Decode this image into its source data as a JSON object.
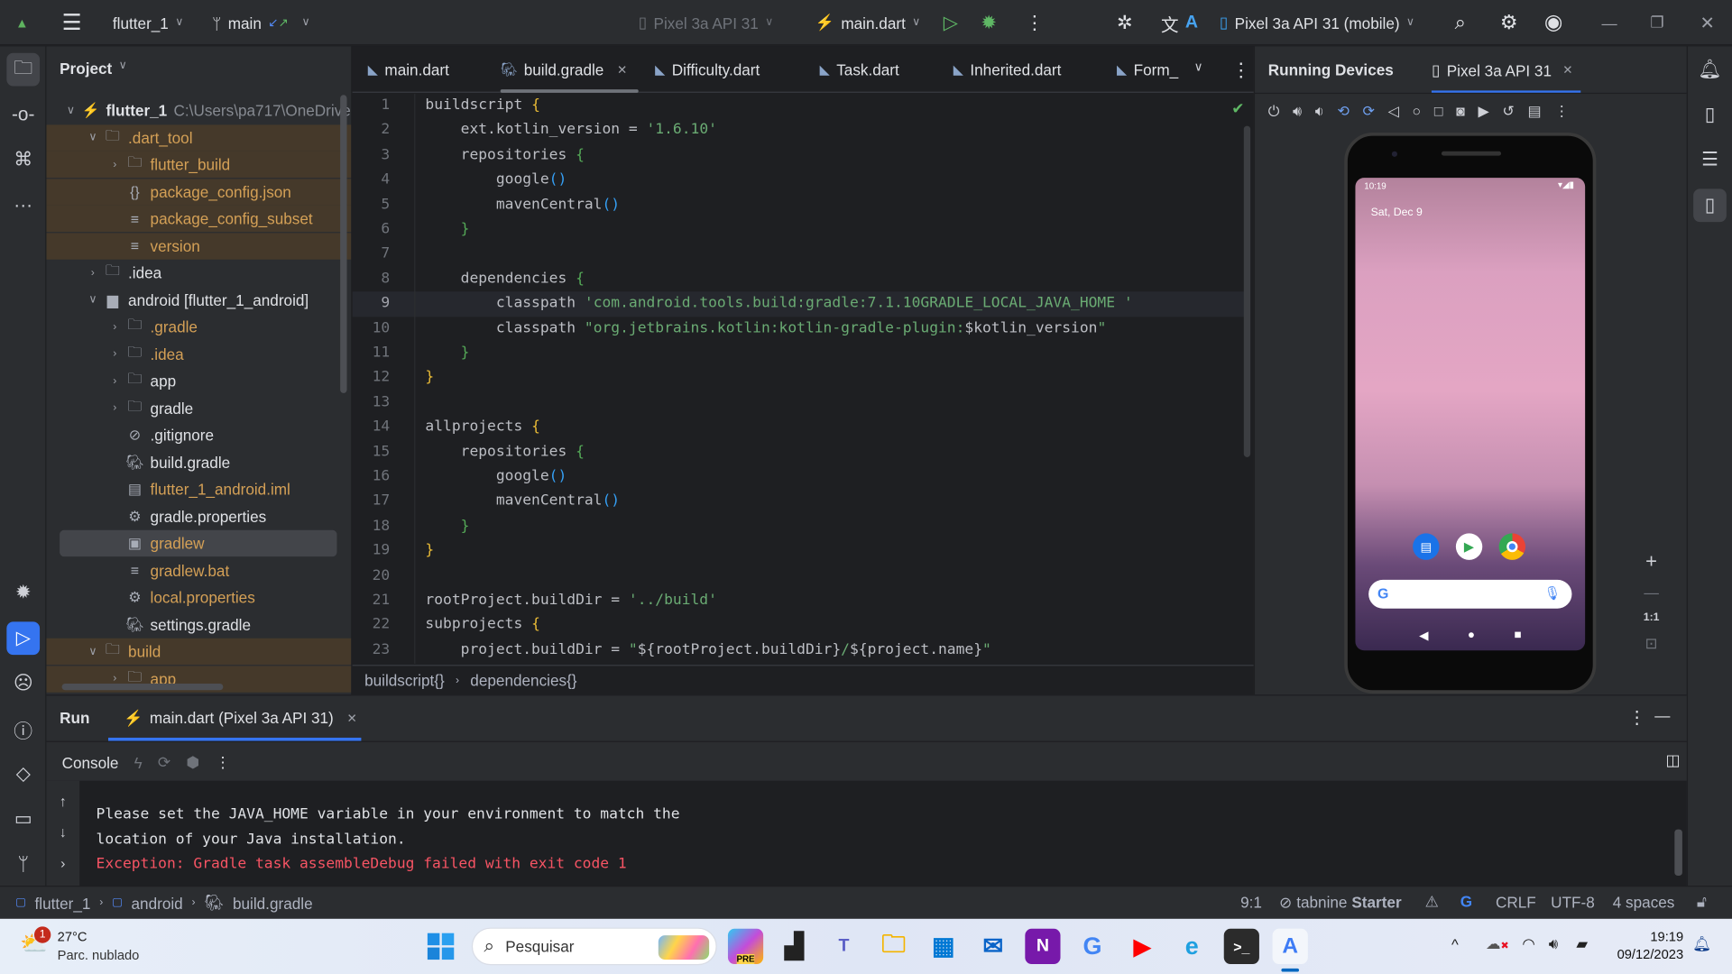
{
  "topbar": {
    "project": "flutter_1",
    "branch": "main",
    "device_config": "Pixel 3a API 31",
    "run_config": "main.dart",
    "device_selector": "Pixel 3a API 31 (mobile)"
  },
  "project_panel": {
    "title": "Project",
    "tree": [
      {
        "name": "flutter_1",
        "extra": "C:\\Users\\pa717\\OneDrive",
        "level": 0,
        "chev": "v",
        "icon": "flutter-icon",
        "color": "#dfe1e5",
        "bg": ""
      },
      {
        "name": ".dart_tool",
        "level": 1,
        "chev": "v",
        "icon": "folder-icon",
        "color": "#d4a056",
        "bg": "#45392a"
      },
      {
        "name": "flutter_build",
        "level": 2,
        "chev": ">",
        "icon": "folder-icon",
        "color": "#d4a056",
        "bg": "#45392a"
      },
      {
        "name": "package_config.json",
        "level": 2,
        "chev": "",
        "icon": "json-icon",
        "color": "#d4a056",
        "bg": "#45392a"
      },
      {
        "name": "package_config_subset",
        "level": 2,
        "chev": "",
        "icon": "text-file-icon",
        "color": "#d4a056",
        "bg": "#45392a"
      },
      {
        "name": "version",
        "level": 2,
        "chev": "",
        "icon": "text-file-icon",
        "color": "#d4a056",
        "bg": "#45392a"
      },
      {
        "name": ".idea",
        "level": 1,
        "chev": ">",
        "icon": "folder-icon",
        "color": "#dfe1e5",
        "bg": ""
      },
      {
        "name": "android [flutter_1_android]",
        "level": 1,
        "chev": "v",
        "icon": "module-folder-icon",
        "color": "#dfe1e5",
        "bg": ""
      },
      {
        "name": ".gradle",
        "level": 2,
        "chev": ">",
        "icon": "folder-icon",
        "color": "#d4a056",
        "bg": ""
      },
      {
        "name": ".idea",
        "level": 2,
        "chev": ">",
        "icon": "folder-icon",
        "color": "#d4a056",
        "bg": ""
      },
      {
        "name": "app",
        "level": 2,
        "chev": ">",
        "icon": "folder-icon",
        "color": "#dfe1e5",
        "bg": ""
      },
      {
        "name": "gradle",
        "level": 2,
        "chev": ">",
        "icon": "folder-icon",
        "color": "#dfe1e5",
        "bg": ""
      },
      {
        "name": ".gitignore",
        "level": 2,
        "chev": "",
        "icon": "ignore-file-icon",
        "color": "#dfe1e5",
        "bg": ""
      },
      {
        "name": "build.gradle",
        "level": 2,
        "chev": "",
        "icon": "gradle-icon",
        "color": "#dfe1e5",
        "bg": ""
      },
      {
        "name": "flutter_1_android.iml",
        "level": 2,
        "chev": "",
        "icon": "iml-file-icon",
        "color": "#d4a056",
        "bg": ""
      },
      {
        "name": "gradle.properties",
        "level": 2,
        "chev": "",
        "icon": "gear-icon",
        "color": "#dfe1e5",
        "bg": ""
      },
      {
        "name": "gradlew",
        "level": 2,
        "chev": "",
        "icon": "script-icon",
        "color": "#d4a056",
        "bg": "#43454a"
      },
      {
        "name": "gradlew.bat",
        "level": 2,
        "chev": "",
        "icon": "text-file-icon",
        "color": "#d4a056",
        "bg": ""
      },
      {
        "name": "local.properties",
        "level": 2,
        "chev": "",
        "icon": "gear-icon",
        "color": "#d4a056",
        "bg": ""
      },
      {
        "name": "settings.gradle",
        "level": 2,
        "chev": "",
        "icon": "gradle-icon",
        "color": "#dfe1e5",
        "bg": ""
      },
      {
        "name": "build",
        "level": 1,
        "chev": "v",
        "icon": "folder-icon",
        "color": "#d4a056",
        "bg": "#45392a"
      },
      {
        "name": "app",
        "level": 2,
        "chev": ">",
        "icon": "folder-icon",
        "color": "#d4a056",
        "bg": "#45392a"
      }
    ]
  },
  "editor": {
    "tabs": [
      {
        "label": "main.dart",
        "icon": "dart-file-icon"
      },
      {
        "label": "build.gradle",
        "icon": "gradle-icon",
        "active": true,
        "closable": true
      },
      {
        "label": "Difficulty.dart",
        "icon": "dart-file-icon"
      },
      {
        "label": "Task.dart",
        "icon": "dart-file-icon"
      },
      {
        "label": "Inherited.dart",
        "icon": "dart-file-icon"
      },
      {
        "label": "Form_",
        "icon": "dart-file-icon"
      }
    ],
    "current_line": 9,
    "lines": [
      [
        [
          "buildscript ",
          "plain"
        ],
        [
          "{",
          "brace1"
        ]
      ],
      [
        [
          "    ext.kotlin_version = ",
          "plain"
        ],
        [
          "'1.6.10'",
          "str"
        ]
      ],
      [
        [
          "    repositories ",
          "plain"
        ],
        [
          "{",
          "brace2"
        ]
      ],
      [
        [
          "        google",
          "plain"
        ],
        [
          "()",
          "brace3"
        ]
      ],
      [
        [
          "        mavenCentral",
          "plain"
        ],
        [
          "()",
          "brace3"
        ]
      ],
      [
        [
          "    ",
          "plain"
        ],
        [
          "}",
          "brace2"
        ]
      ],
      [],
      [
        [
          "    dependencies ",
          "plain"
        ],
        [
          "{",
          "brace2"
        ]
      ],
      [
        [
          "        classpath ",
          "plain"
        ],
        [
          "'com.android.tools.build:gradle:7.1.10GRADLE_LOCAL_JAVA_HOME '",
          "str"
        ]
      ],
      [
        [
          "        classpath ",
          "plain"
        ],
        [
          "\"org.jetbrains.kotlin:kotlin-gradle-plugin:",
          "str"
        ],
        [
          "$kotlin_version",
          "plain"
        ],
        [
          "\"",
          "str"
        ]
      ],
      [
        [
          "    ",
          "plain"
        ],
        [
          "}",
          "brace2"
        ]
      ],
      [
        [
          "}",
          "brace1"
        ]
      ],
      [],
      [
        [
          "allprojects ",
          "plain"
        ],
        [
          "{",
          "brace1"
        ]
      ],
      [
        [
          "    repositories ",
          "plain"
        ],
        [
          "{",
          "brace2"
        ]
      ],
      [
        [
          "        google",
          "plain"
        ],
        [
          "()",
          "brace3"
        ]
      ],
      [
        [
          "        mavenCentral",
          "plain"
        ],
        [
          "()",
          "brace3"
        ]
      ],
      [
        [
          "    ",
          "plain"
        ],
        [
          "}",
          "brace2"
        ]
      ],
      [
        [
          "}",
          "brace1"
        ]
      ],
      [],
      [
        [
          "rootProject.buildDir = ",
          "plain"
        ],
        [
          "'../build'",
          "str"
        ]
      ],
      [
        [
          "subprojects ",
          "plain"
        ],
        [
          "{",
          "brace1"
        ]
      ],
      [
        [
          "    project.buildDir = ",
          "plain"
        ],
        [
          "\"",
          "str"
        ],
        [
          "${rootProject.buildDir}",
          "plain"
        ],
        [
          "/",
          "str"
        ],
        [
          "${project.name}",
          "plain"
        ],
        [
          "\"",
          "str"
        ]
      ]
    ],
    "breadcrumb": [
      "buildscript{}",
      "dependencies{}"
    ]
  },
  "running_devices": {
    "title": "Running Devices",
    "tab": "Pixel 3a API 31",
    "phone": {
      "time": "10:19",
      "date": "Sat, Dec 9"
    },
    "zoom_reset": "1:1"
  },
  "run_panel": {
    "title": "Run",
    "tab": "main.dart (Pixel 3a API 31)",
    "console_label": "Console",
    "output": [
      {
        "text": "Please set the JAVA_HOME variable in your environment to match the",
        "color": "#dfe1e5"
      },
      {
        "text": "location of your Java installation.",
        "color": "#dfe1e5"
      },
      {
        "text": "Exception: Gradle task assembleDebug failed with exit code 1",
        "color": "#f75464"
      }
    ]
  },
  "statusbar": {
    "path": [
      "flutter_1",
      "android",
      "build.gradle"
    ],
    "position": "9:1",
    "tabnine": "tabnine",
    "tabnine_plan": "Starter",
    "line_sep": "CRLF",
    "encoding": "UTF-8",
    "indent": "4 spaces"
  },
  "taskbar": {
    "weather_temp": "27°C",
    "weather_desc": "Parc. nublado",
    "weather_badge": "1",
    "search_placeholder": "Pesquisar",
    "time": "19:19",
    "date": "09/12/2023",
    "copilot_badge": "PRE"
  }
}
